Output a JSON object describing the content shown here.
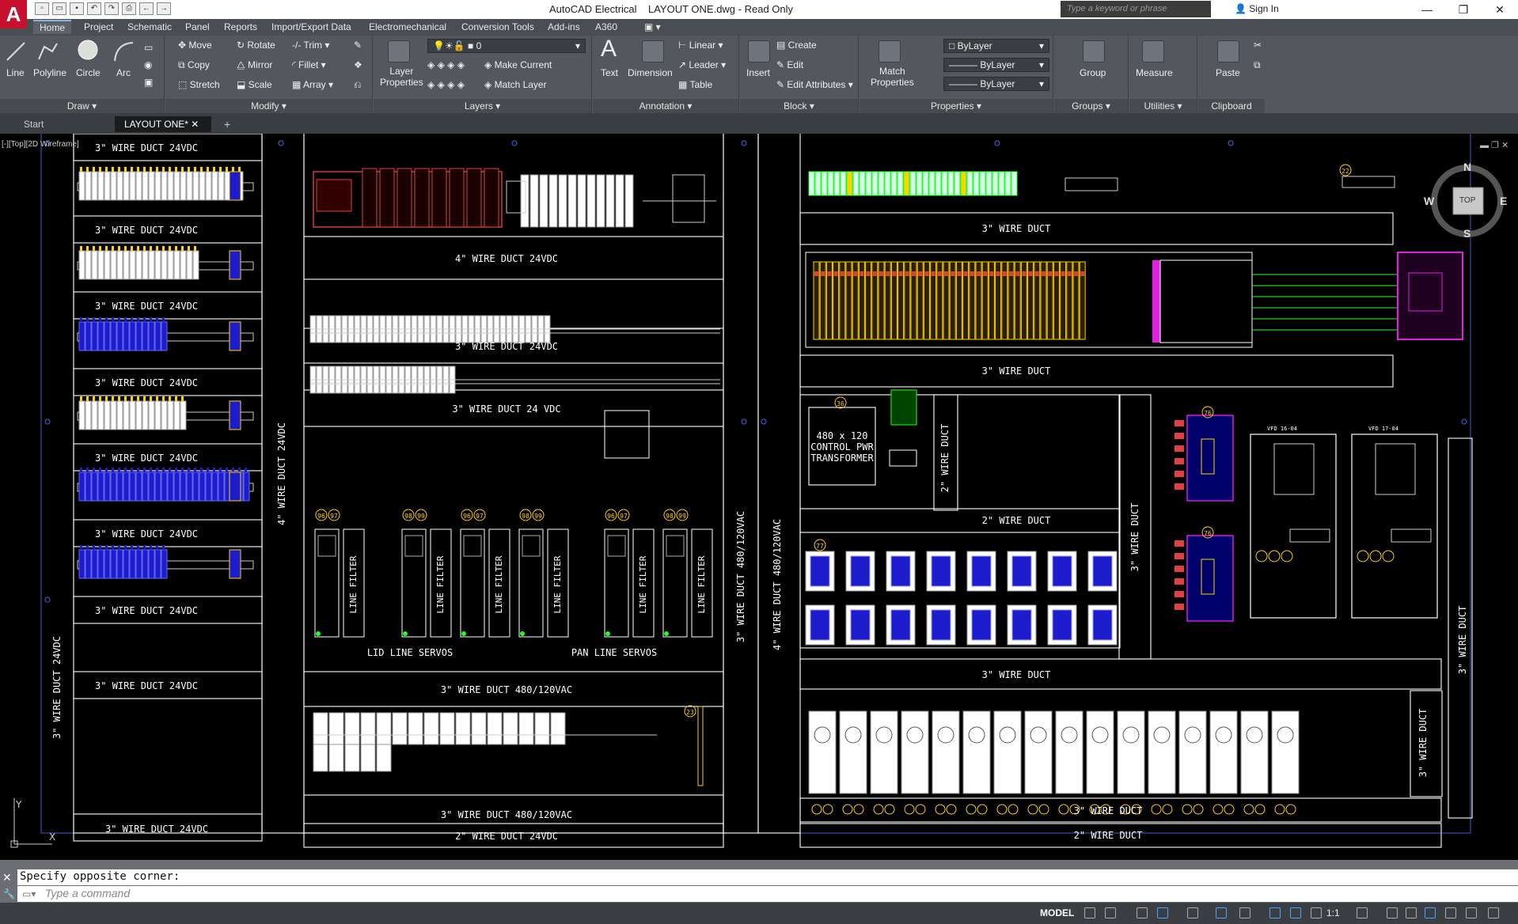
{
  "app": {
    "logo": "A",
    "title": "AutoCAD Electrical    LAYOUT ONE.dwg - Read Only",
    "search_placeholder": "Type a keyword or phrase",
    "signin": "Sign In",
    "window_buttons": [
      "—",
      "❐",
      "✕"
    ]
  },
  "ribbon_tabs": [
    {
      "label": "Home",
      "active": true
    },
    {
      "label": "Project"
    },
    {
      "label": "Schematic"
    },
    {
      "label": "Panel"
    },
    {
      "label": "Reports"
    },
    {
      "label": "Import/Export Data"
    },
    {
      "label": "Electromechanical"
    },
    {
      "label": "Conversion Tools"
    },
    {
      "label": "Add-ins"
    },
    {
      "label": "A360"
    }
  ],
  "ribbon": {
    "draw": {
      "label": "Draw ▾",
      "tools": [
        "Line",
        "Polyline",
        "Circle",
        "Arc"
      ]
    },
    "modify": {
      "label": "Modify ▾",
      "tools": [
        "Move",
        "Rotate",
        "Trim",
        "Copy",
        "Mirror",
        "Fillet",
        "Stretch",
        "Scale",
        "Array"
      ]
    },
    "layers": {
      "label": "Layers ▾",
      "big": "Layer\nProperties",
      "current_layer": "0",
      "tools": [
        "Make Current",
        "Match Layer"
      ]
    },
    "annotation": {
      "label": "Annotation ▾",
      "big": [
        "Text",
        "Dimension"
      ],
      "tools": [
        "Linear",
        "Leader",
        "Table"
      ]
    },
    "block": {
      "label": "Block ▾",
      "big": "Insert",
      "tools": [
        "Create",
        "Edit",
        "Edit Attributes"
      ]
    },
    "properties": {
      "label": "Properties ▾",
      "big": "Match\nProperties",
      "color": "ByLayer",
      "linetype": "ByLayer",
      "lineweight": "ByLayer"
    },
    "groups": {
      "label": "Groups ▾",
      "big": "Group"
    },
    "utilities": {
      "label": "Utilities ▾",
      "big": "Measure"
    },
    "clipboard": {
      "label": "Clipboard",
      "big": "Paste"
    }
  },
  "doc_tabs": [
    {
      "label": "Start"
    },
    {
      "label": "LAYOUT ONE*",
      "active": true
    }
  ],
  "viewport_label": "[-][Top][2D Wireframe]",
  "viewcube": {
    "top": "TOP",
    "n": "N",
    "s": "S",
    "e": "E",
    "w": "W"
  },
  "drawing": {
    "left_col_ducts": [
      "3\" WIRE DUCT  24VDC",
      "3\" WIRE DUCT  24VDC",
      "3\" WIRE DUCT  24VDC",
      "3\" WIRE DUCT  24VDC",
      "3\" WIRE DUCT  24VDC",
      "3\" WIRE DUCT  24VDC",
      "3\" WIRE DUCT  24VDC",
      "3\" WIRE DUCT  24VDC"
    ],
    "left_vertical": "3\" WIRE DUCT  24VDC",
    "vertical_4in": "4\" WIRE DUCT  24VDC",
    "center_ducts": [
      "4\" WIRE DUCT  24VDC",
      "3\" WIRE DUCT  24VDC",
      "3\" WIRE DUCT  24 VDC",
      "3\" WIRE DUCT  480/120VAC",
      "3\" WIRE DUCT  480/120VAC",
      "2\" WIRE DUCT  24VDC"
    ],
    "center_vertical": "3\" WIRE DUCT  480/120VAC",
    "servo_labels": [
      "LID LINE SERVOS",
      "PAN LINE SERVOS"
    ],
    "line_filter": "LINE FILTER",
    "right_vertical_4in": "4\" WIRE DUCT  480/120VAC",
    "right_ducts": [
      "3\" WIRE DUCT",
      "3\" WIRE DUCT",
      "2\" WIRE DUCT",
      "3\" WIRE DUCT",
      "3\" WIRE DUCT",
      "2\" WIRE DUCT"
    ],
    "right_small_vertical": [
      "2\" WIRE DUCT",
      "3\" WIRE DUCT",
      "3\" WIRE DUCT",
      "3\" WIRE DUCT"
    ],
    "transformer": [
      "480 x 120",
      "CONTROL PWR",
      "TRANSFORMER"
    ],
    "vfd_labels": [
      "VFD 16-04",
      "VFD 17-04"
    ],
    "balloons": [
      "22",
      "36",
      "76",
      "76",
      "77",
      "23"
    ],
    "servo_balloons": [
      "96",
      "97",
      "98",
      "99"
    ]
  },
  "command": {
    "history": "Specify opposite corner:",
    "placeholder": "Type a command"
  },
  "status": {
    "model": "MODEL",
    "scale": "1:1"
  },
  "colors": {
    "ribbon": "#54585e",
    "canvas": "#000000",
    "duct_line": "#ffffff",
    "enclosure": "#3a55c8",
    "plc": "#e04040",
    "terminal_yellow": "#ffd200",
    "terminal_blue": "#1c1ccc",
    "magenta": "#e020e0",
    "green": "#20ff20"
  }
}
